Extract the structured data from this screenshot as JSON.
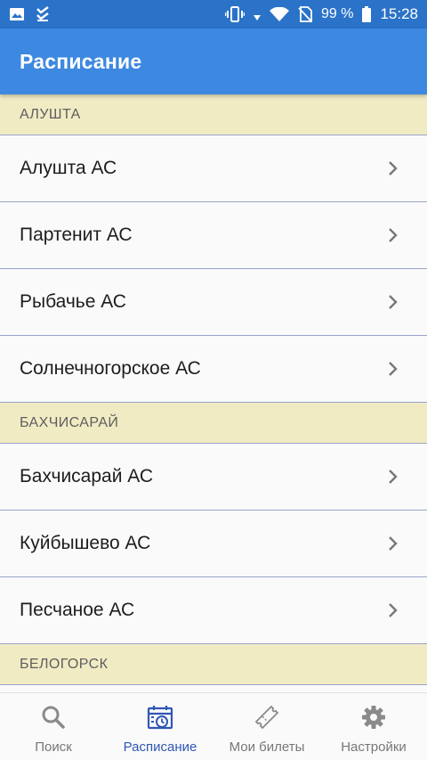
{
  "status_bar": {
    "battery_text": "99 %",
    "time": "15:28",
    "icons": [
      "image-icon",
      "checklist-icon",
      "vibrate-icon",
      "data-arrows-icon",
      "wifi-icon",
      "no-sim-icon",
      "battery-icon"
    ]
  },
  "app_bar": {
    "title": "Расписание"
  },
  "sections": [
    {
      "header": "АЛУШТА",
      "items": [
        "Алушта АС",
        "Партенит АС",
        "Рыбачье АС",
        "Солнечногорское АС"
      ]
    },
    {
      "header": "БАХЧИСАРАЙ",
      "items": [
        "Бахчисарай АС",
        "Куйбышево АС",
        "Песчаное АС"
      ]
    },
    {
      "header": "БЕЛОГОРСК",
      "items": []
    }
  ],
  "bottom_nav": {
    "active": "Расписание",
    "items": [
      {
        "label": "Поиск",
        "icon": "search-icon"
      },
      {
        "label": "Расписание",
        "icon": "schedule-calendar-icon"
      },
      {
        "label": "Мои билеты",
        "icon": "ticket-icon"
      },
      {
        "label": "Настройки",
        "icon": "gear-icon"
      }
    ]
  },
  "colors": {
    "status_bar": "#2b73c8",
    "app_bar": "#3d88e0",
    "section_header": "#f1ebc4",
    "active_nav": "#3056b5"
  }
}
